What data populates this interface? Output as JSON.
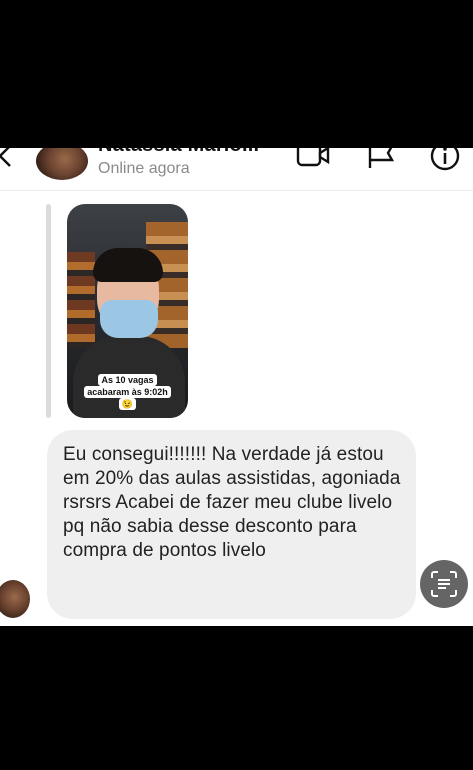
{
  "header": {
    "contact_name": "Natassia Mario...",
    "status": "Online agora",
    "icons": [
      "back-arrow-icon",
      "video-call-icon",
      "flag-icon",
      "info-icon"
    ]
  },
  "story": {
    "caption": "As 10 vagas acabaram às 9:02h 😉"
  },
  "message": {
    "text": "Eu consegui!!!!!!! Na verdade já estou em 20% das aulas assistidas, agoniada rsrsrs Acabei de fazer meu clube livelo pq não sabia desse desconto para compra de pontos livelo"
  },
  "colors": {
    "bubble": "#efefef",
    "status_text": "#8a8a8a",
    "translate_button": "#656565"
  }
}
